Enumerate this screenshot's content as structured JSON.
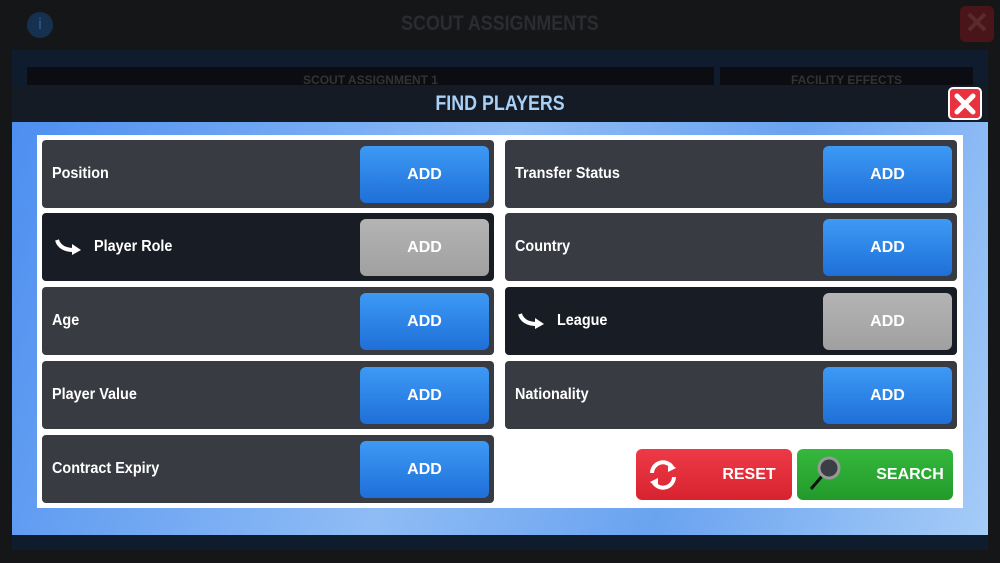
{
  "background": {
    "title": "SCOUT ASSIGNMENTS",
    "tabs": [
      "SCOUT ASSIGNMENT 1",
      "FACILITY EFFECTS"
    ],
    "info_icon": "info-icon",
    "close_icon": "close-icon"
  },
  "modal": {
    "title": "FIND PLAYERS",
    "close_icon": "close-icon",
    "left": [
      {
        "label": "Position",
        "button": "ADD",
        "enabled": true,
        "sub": false
      },
      {
        "label": "Player Role",
        "button": "ADD",
        "enabled": false,
        "sub": true
      },
      {
        "label": "Age",
        "button": "ADD",
        "enabled": true,
        "sub": false
      },
      {
        "label": "Player Value",
        "button": "ADD",
        "enabled": true,
        "sub": false
      },
      {
        "label": "Contract Expiry",
        "button": "ADD",
        "enabled": true,
        "sub": false
      }
    ],
    "right": [
      {
        "label": "Transfer Status",
        "button": "ADD",
        "enabled": true,
        "sub": false
      },
      {
        "label": "Country",
        "button": "ADD",
        "enabled": true,
        "sub": false
      },
      {
        "label": "League",
        "button": "ADD",
        "enabled": false,
        "sub": true
      },
      {
        "label": "Nationality",
        "button": "ADD",
        "enabled": true,
        "sub": false
      }
    ],
    "reset": "RESET",
    "search": "SEARCH"
  },
  "colors": {
    "add": "#2a85ea",
    "disabled": "#aaaaaa",
    "reset": "#e32d3b",
    "search": "#2ca934"
  }
}
